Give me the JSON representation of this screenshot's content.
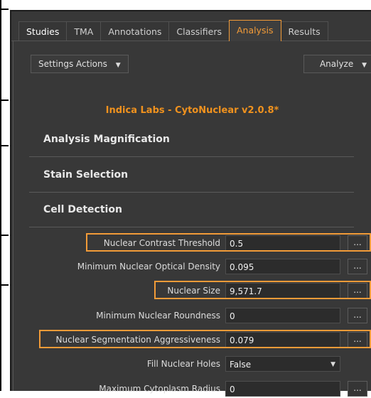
{
  "tabs": [
    {
      "label": "Studies"
    },
    {
      "label": "TMA"
    },
    {
      "label": "Annotations"
    },
    {
      "label": "Classifiers"
    },
    {
      "label": "Analysis"
    },
    {
      "label": "Results"
    }
  ],
  "active_tab": "Analysis",
  "toolbar": {
    "settings_actions": "Settings Actions",
    "analyze": "Analyze"
  },
  "plugin_title": "Indica Labs - CytoNuclear v2.0.8*",
  "sections": [
    {
      "label": "Analysis Magnification"
    },
    {
      "label": "Stain Selection"
    },
    {
      "label": "Cell Detection"
    }
  ],
  "params": [
    {
      "label": "Nuclear Contrast Threshold",
      "value": "0.5",
      "more": "...",
      "highlighted": true
    },
    {
      "label": "Minimum Nuclear Optical Density",
      "value": "0.095",
      "more": "...",
      "highlighted": false
    },
    {
      "label": "Nuclear Size",
      "value": "9,571.7",
      "more": "...",
      "highlighted": true
    },
    {
      "label": "Minimum Nuclear Roundness",
      "value": "0",
      "more": "...",
      "highlighted": false
    },
    {
      "label": "Nuclear Segmentation Aggressiveness",
      "value": "0.079",
      "more": "...",
      "highlighted": true
    },
    {
      "label": "Fill Nuclear Holes",
      "value": "False",
      "highlighted": false
    },
    {
      "label": "Maximum Cytoplasm Radius",
      "value": "0",
      "more": "...",
      "highlighted": false
    }
  ],
  "colors": {
    "accent": "#f29b38",
    "background": "#383838",
    "plugin_title": "#f0921e"
  },
  "icons": {
    "dropdown": "chevron-down-icon"
  }
}
